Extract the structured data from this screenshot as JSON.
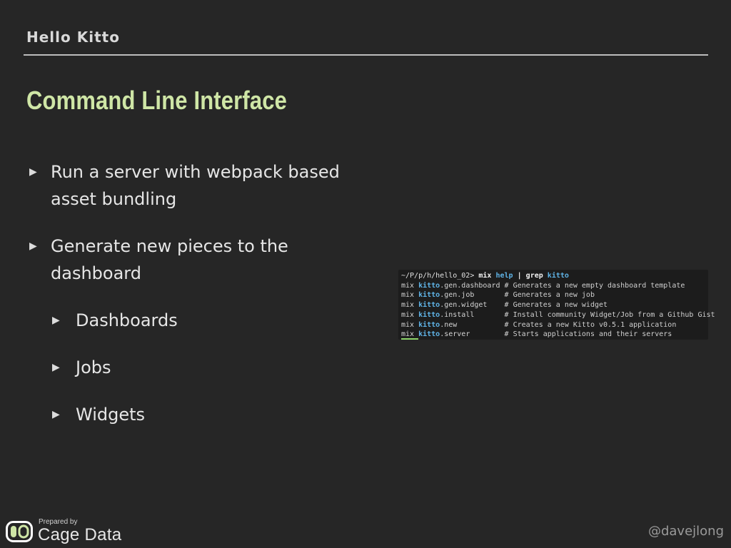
{
  "header": {
    "section_title": "Hello Kitto"
  },
  "slide": {
    "title": "Command Line Interface",
    "bullets": [
      {
        "text": "Run a server with webpack based asset bundling",
        "level": 1
      },
      {
        "text": "Generate new pieces to the dashboard",
        "level": 1
      },
      {
        "text": "Dashboards",
        "level": 2
      },
      {
        "text": "Jobs",
        "level": 2
      },
      {
        "text": "Widgets",
        "level": 2
      }
    ],
    "bullet_marker": "▶"
  },
  "terminal": {
    "prompt": "~/P/p/h/hello_02>",
    "command_mix": "mix",
    "command_help": "help",
    "command_pipe": "|",
    "command_grep": "grep",
    "command_grep_arg": "kitto",
    "lines": [
      {
        "prefix": "mix ",
        "task_kw": "kitto",
        "task_rest": ".gen.dashboard",
        "pad": " ",
        "comment": "# Generates a new empty dashboard template"
      },
      {
        "prefix": "mix ",
        "task_kw": "kitto",
        "task_rest": ".gen.job",
        "pad": "       ",
        "comment": "# Generates a new job"
      },
      {
        "prefix": "mix ",
        "task_kw": "kitto",
        "task_rest": ".gen.widget",
        "pad": "    ",
        "comment": "# Generates a new widget"
      },
      {
        "prefix": "mix ",
        "task_kw": "kitto",
        "task_rest": ".install",
        "pad": "       ",
        "comment": "# Install community Widget/Job from a Github Gist"
      },
      {
        "prefix": "mix ",
        "task_kw": "kitto",
        "task_rest": ".new",
        "pad": "           ",
        "comment": "# Creates a new Kitto v0.5.1 application"
      },
      {
        "prefix": "mix ",
        "task_kw": "kitto",
        "task_rest": ".server",
        "pad": "        ",
        "comment": "# Starts applications and their servers"
      }
    ]
  },
  "footer": {
    "prepared_by": "Prepared by",
    "company": "Cage Data",
    "handle": "@davejlong"
  },
  "colors": {
    "background": "#262626",
    "title_accent": "#cfe6a6",
    "terminal_bg": "#1c1c1c",
    "terminal_keyword": "#5fb3e6",
    "cursor_accent": "#8cd46a"
  },
  "icons": {
    "bullet": "triangle-right-icon",
    "logo": "cage-data-logo-icon"
  }
}
